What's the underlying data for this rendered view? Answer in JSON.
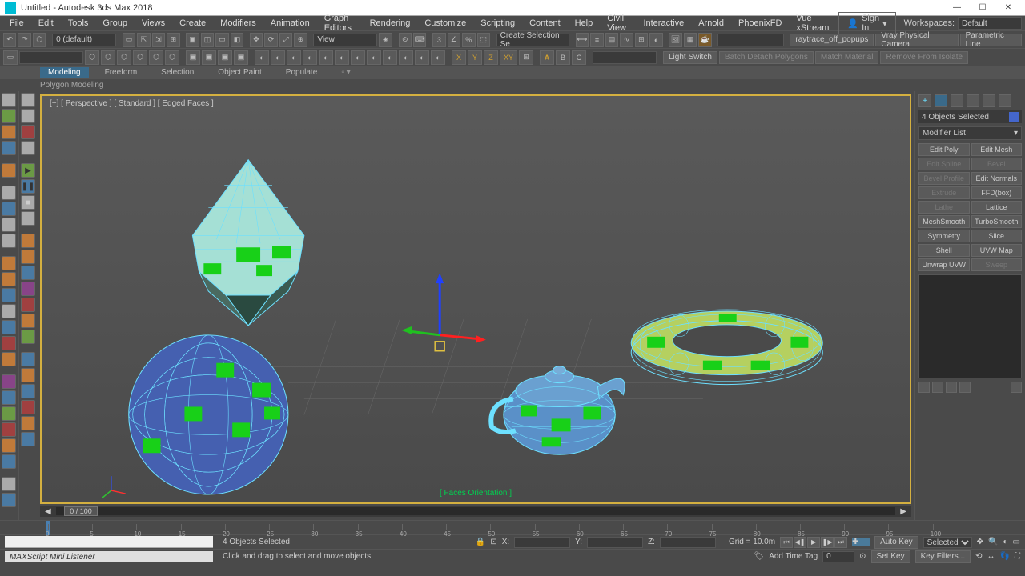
{
  "titlebar": {
    "title": "Untitled - Autodesk 3ds Max 2018"
  },
  "window_buttons": {
    "min": "—",
    "max": "☐",
    "close": "✕"
  },
  "menu": [
    "File",
    "Edit",
    "Tools",
    "Group",
    "Views",
    "Create",
    "Modifiers",
    "Animation",
    "Graph Editors",
    "Rendering",
    "Customize",
    "Scripting",
    "Content",
    "Help",
    "Civil View",
    "Interactive",
    "Arnold",
    "PhoenixFD",
    "Vue xStream"
  ],
  "signin": "Sign In",
  "workspaces": {
    "label": "Workspaces:",
    "value": "Default"
  },
  "toolbar1": {
    "selection_set": "0 (default)",
    "view_label": "View",
    "create_sel_set": "Create Selection Se",
    "right_buttons": [
      "raytrace_off_popups",
      "Vray Physical Camera",
      "Parametric Line"
    ]
  },
  "toolbar2": {
    "axes": [
      "X",
      "Y",
      "Z",
      "XY"
    ],
    "right_buttons": [
      "Light Switch",
      "Batch Detach Polygons",
      "Match Material",
      "Remove From Isolate"
    ]
  },
  "ribbon": {
    "tabs": [
      "Modeling",
      "Freeform",
      "Selection",
      "Object Paint",
      "Populate"
    ],
    "active": "Modeling",
    "sub": "Polygon Modeling"
  },
  "viewport": {
    "label": "[+] [ Perspective ] [ Standard ] [ Edged Faces ]",
    "overlay": "[ Faces Orientation ]"
  },
  "time": {
    "pos": "0 / 100",
    "ticks": [
      "0",
      "5",
      "10",
      "15",
      "20",
      "25",
      "30",
      "35",
      "40",
      "45",
      "50",
      "55",
      "60",
      "65",
      "70",
      "75",
      "80",
      "85",
      "90",
      "95",
      "100"
    ]
  },
  "rightpanel": {
    "selection_text": "4 Objects Selected",
    "modifier_list": "Modifier List",
    "mods": [
      {
        "l": "Edit Poly",
        "r": "Edit Mesh",
        "ld": false,
        "rd": false
      },
      {
        "l": "Edit Spline",
        "r": "Bevel",
        "ld": true,
        "rd": true
      },
      {
        "l": "Bevel Profile",
        "r": "Edit Normals",
        "ld": true,
        "rd": false
      },
      {
        "l": "Extrude",
        "r": "FFD(box)",
        "ld": true,
        "rd": false
      },
      {
        "l": "Lathe",
        "r": "Lattice",
        "ld": true,
        "rd": false
      },
      {
        "l": "MeshSmooth",
        "r": "TurboSmooth",
        "ld": false,
        "rd": false
      },
      {
        "l": "Symmetry",
        "r": "Slice",
        "ld": false,
        "rd": false
      },
      {
        "l": "Shell",
        "r": "UVW Map",
        "ld": false,
        "rd": false
      },
      {
        "l": "Unwrap UVW",
        "r": "Sweep",
        "ld": false,
        "rd": true
      }
    ]
  },
  "status": {
    "listener": "MAXScript Mini Listener",
    "sel": "4 Objects Selected",
    "hint": "Click and drag to select and move objects",
    "coords": {
      "x": "X:",
      "y": "Y:",
      "z": "Z:",
      "grid": "Grid = 10.0m"
    },
    "add_time_tag": "Add Time Tag",
    "autokey": "Auto Key",
    "setkey": "Set Key",
    "selected": "Selected",
    "keyfilters": "Key Filters..."
  }
}
